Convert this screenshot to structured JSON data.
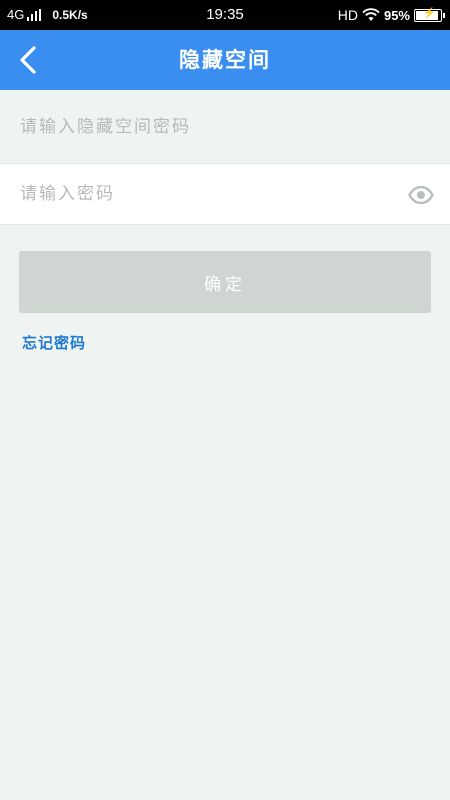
{
  "status_bar": {
    "network": "4G",
    "speed": "0.5K/s",
    "time": "19:35",
    "hd": "HD",
    "battery": "95%",
    "battery_level": 0.95
  },
  "nav": {
    "title": "隐藏空间",
    "back_icon": "chevron-left-icon"
  },
  "form": {
    "space_password_placeholder": "请输入隐藏空间密码",
    "password_placeholder": "请输入密码",
    "eye_icon": "eye-icon",
    "confirm_label": "确定",
    "forgot_label": "忘记密码"
  },
  "colors": {
    "nav_bg": "#3a8ef0",
    "page_bg": "#eff4f2",
    "button_disabled": "#cfd5d1",
    "link": "#1f79cf"
  }
}
